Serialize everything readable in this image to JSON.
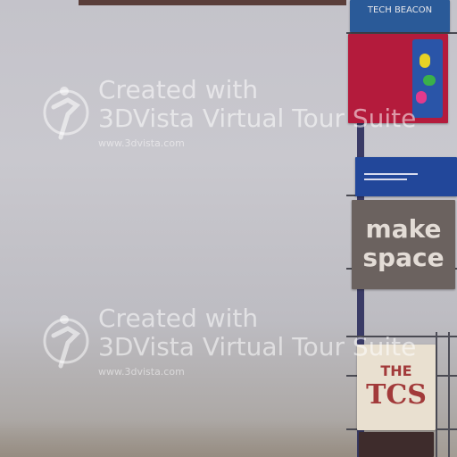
{
  "books": {
    "top_title": "TECH BEACON",
    "middle_title_1": "make",
    "middle_title_2": "space",
    "bottom_title_1": "THE",
    "bottom_title_2": "TCS"
  },
  "watermark": {
    "line1": "Created with",
    "line2": "3DVista Virtual Tour Suite",
    "url": "www.3dvista.com",
    "logo_icon": "3dvista-logo-icon"
  },
  "colors": {
    "wall": "#c6c5cb",
    "rack": "#3a3b66",
    "book_blue": "#23509a",
    "book_red": "#b01a3a",
    "book_grey": "#6d6562"
  }
}
